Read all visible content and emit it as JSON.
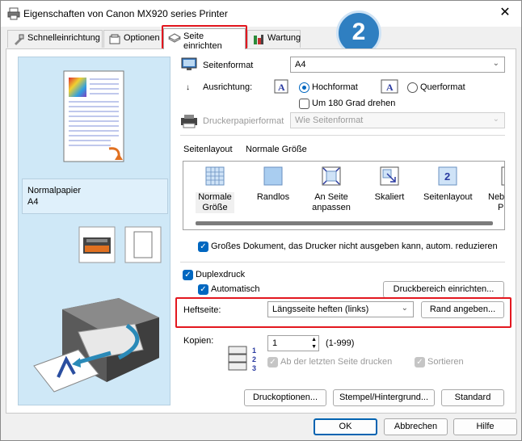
{
  "window": {
    "title": "Eigenschaften von Canon MX920 series Printer"
  },
  "tabs": [
    {
      "label": "Schnelleinrichtung"
    },
    {
      "label": "Optionen"
    },
    {
      "label": "Seite einrichten"
    },
    {
      "label": "Wartung"
    }
  ],
  "badge": "2",
  "preview": {
    "media": "Normalpapier",
    "size": "A4"
  },
  "page_format": {
    "label": "Seitenformat",
    "value": "A4"
  },
  "orientation": {
    "label": "Ausrichtung:",
    "portrait": "Hochformat",
    "landscape": "Querformat",
    "rotate180": "Um 180 Grad drehen"
  },
  "printer_paper": {
    "label": "Druckerpapierformat",
    "value": "Wie Seitenformat"
  },
  "page_layout": {
    "label": "Seitenlayout",
    "current": "Normale Größe",
    "items": [
      {
        "line1": "Normale",
        "line2": "Größe"
      },
      {
        "line1": "Randlos",
        "line2": ""
      },
      {
        "line1": "An Seite",
        "line2": "anpassen"
      },
      {
        "line1": "Skaliert",
        "line2": ""
      },
      {
        "line1": "Seitenlayout",
        "line2": ""
      },
      {
        "line1": "Neb",
        "line2": "P"
      }
    ],
    "layout_icon_digit": "2"
  },
  "large_doc": "Großes Dokument, das Drucker nicht ausgeben kann, autom. reduzieren",
  "duplex": {
    "label": "Duplexdruck",
    "auto": "Automatisch",
    "area_button": "Druckbereich einrichten..."
  },
  "staple": {
    "label": "Heftseite:",
    "value": "Längsseite heften (links)",
    "margin_button": "Rand angeben..."
  },
  "copies": {
    "label": "Kopien:",
    "value": "1",
    "range": "(1-999)",
    "last_page": "Ab der letzten Seite drucken",
    "collate": "Sortieren"
  },
  "bottom_buttons": {
    "options": "Druckoptionen...",
    "stamp": "Stempel/Hintergrund...",
    "default": "Standard"
  },
  "dialog_buttons": {
    "ok": "OK",
    "cancel": "Abbrechen",
    "help": "Hilfe"
  },
  "colors": {
    "accent": "#0067c0",
    "highlight": "#e3171f",
    "badge": "#2f7fc1",
    "preview_bg": "#cfe8f7"
  }
}
